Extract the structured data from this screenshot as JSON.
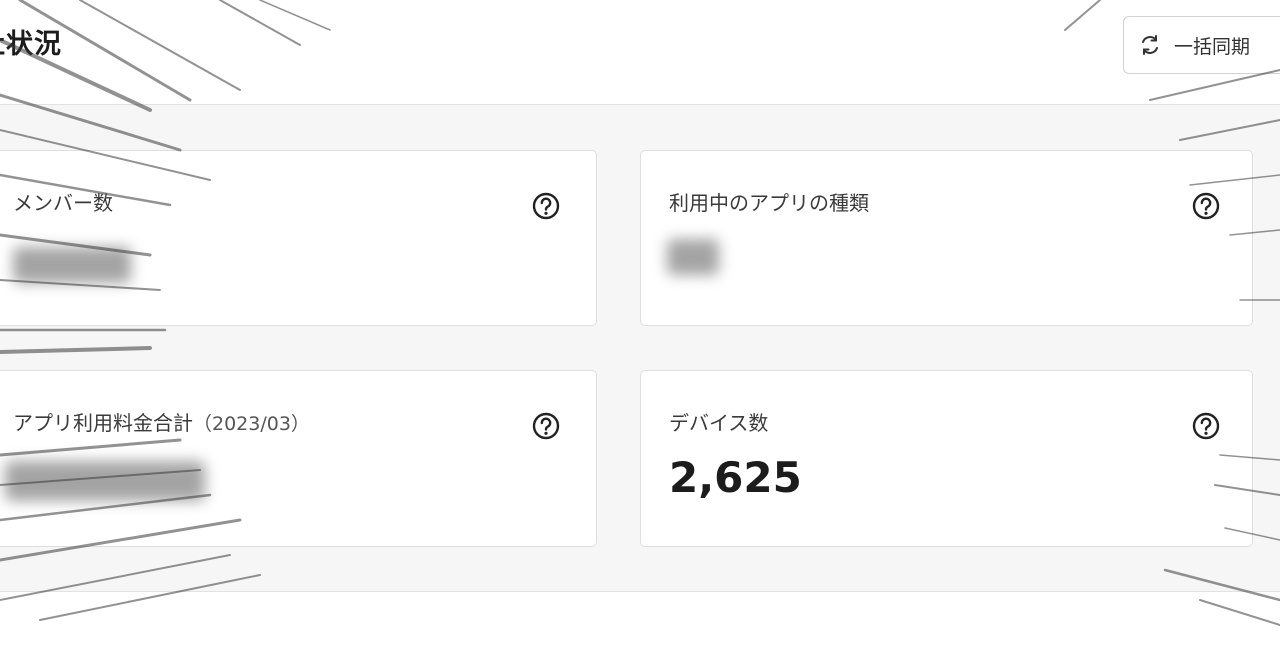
{
  "header": {
    "title": "社状況",
    "sync_button_label": "一括同期"
  },
  "cards": {
    "members": {
      "label": "メンバー数"
    },
    "app_types": {
      "label": "利用中のアプリの種類"
    },
    "app_fee": {
      "label": "アプリ利用料金合計",
      "period": "（2023/03）"
    },
    "devices": {
      "label": "デバイス数",
      "value": "2,625"
    }
  },
  "icons": {
    "sync": "sync-icon",
    "help": "question-circle-icon"
  },
  "colors": {
    "panel_background": "#f6f6f6",
    "card_border": "#dedede",
    "text_primary": "#1c1c1c"
  }
}
